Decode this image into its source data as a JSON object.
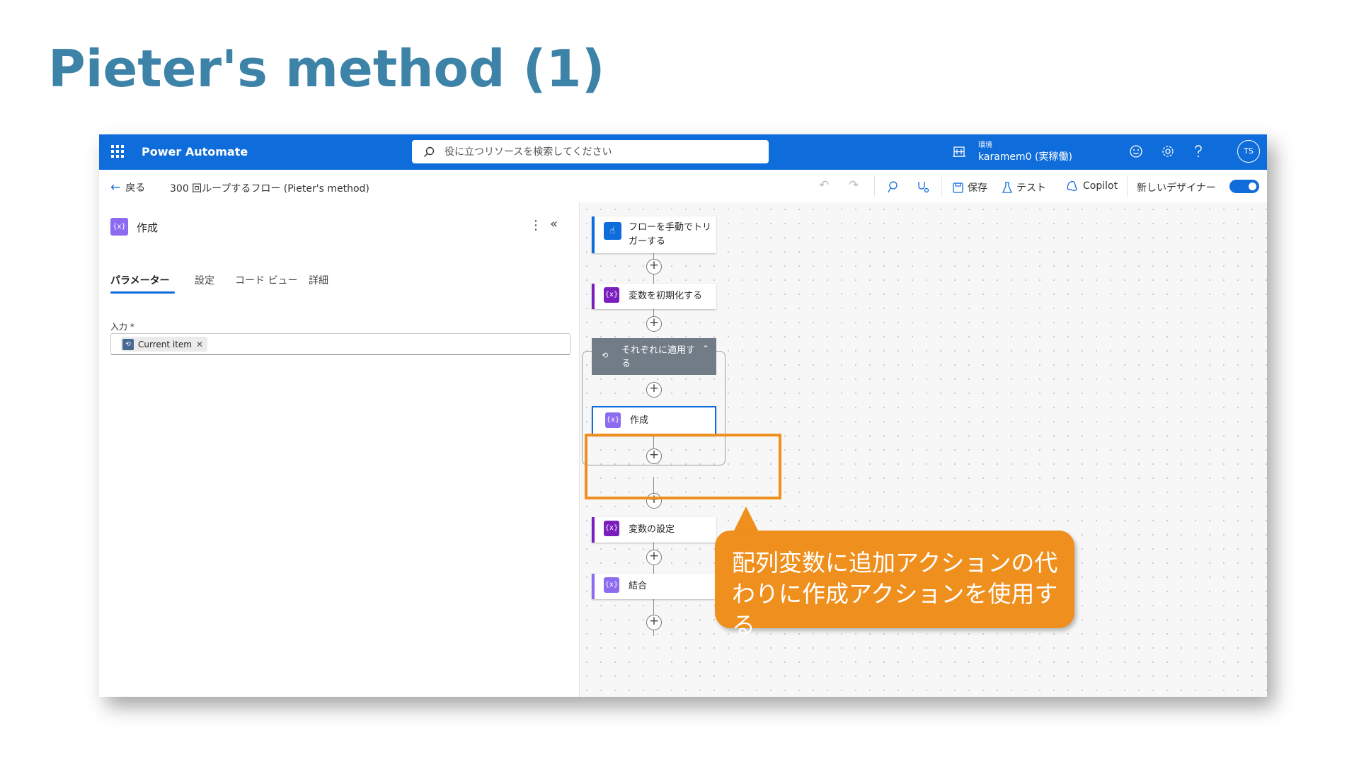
{
  "slide": {
    "title": "Pieter's method (1)"
  },
  "header": {
    "app_name": "Power Automate",
    "search_placeholder": "役に立つリソースを検索してください",
    "environment_label": "環境",
    "environment_name": "karamem0 (実稼働)",
    "avatar_initials": "TS"
  },
  "commandbar": {
    "back_label": "戻る",
    "flow_name": "300 回ループするフロー (Pieter's method)",
    "save_label": "保存",
    "test_label": "テスト",
    "copilot_label": "Copilot",
    "new_designer_label": "新しいデザイナー",
    "new_designer_enabled": true
  },
  "panel": {
    "title": "作成",
    "tabs": [
      "パラメーター",
      "設定",
      "コード ビュー",
      "詳細"
    ],
    "active_tab": "パラメーター",
    "input_label": "入力 *",
    "input_token": "Current item"
  },
  "flow": {
    "trigger": "フローを手動でトリガーする",
    "init_var": "変数を初期化する",
    "loop": "それぞれに適用する",
    "compose": "作成",
    "set_var": "変数の設定",
    "join": "結合"
  },
  "callout": {
    "text": "配列変数に追加アクションの代\nわりに作成アクションを使用する"
  },
  "colors": {
    "brand": "#0f6cdb",
    "accent": "#ef8f1d",
    "title": "#3d83a8",
    "variable": "#7a1fbd",
    "data_op": "#8c6bf0"
  }
}
